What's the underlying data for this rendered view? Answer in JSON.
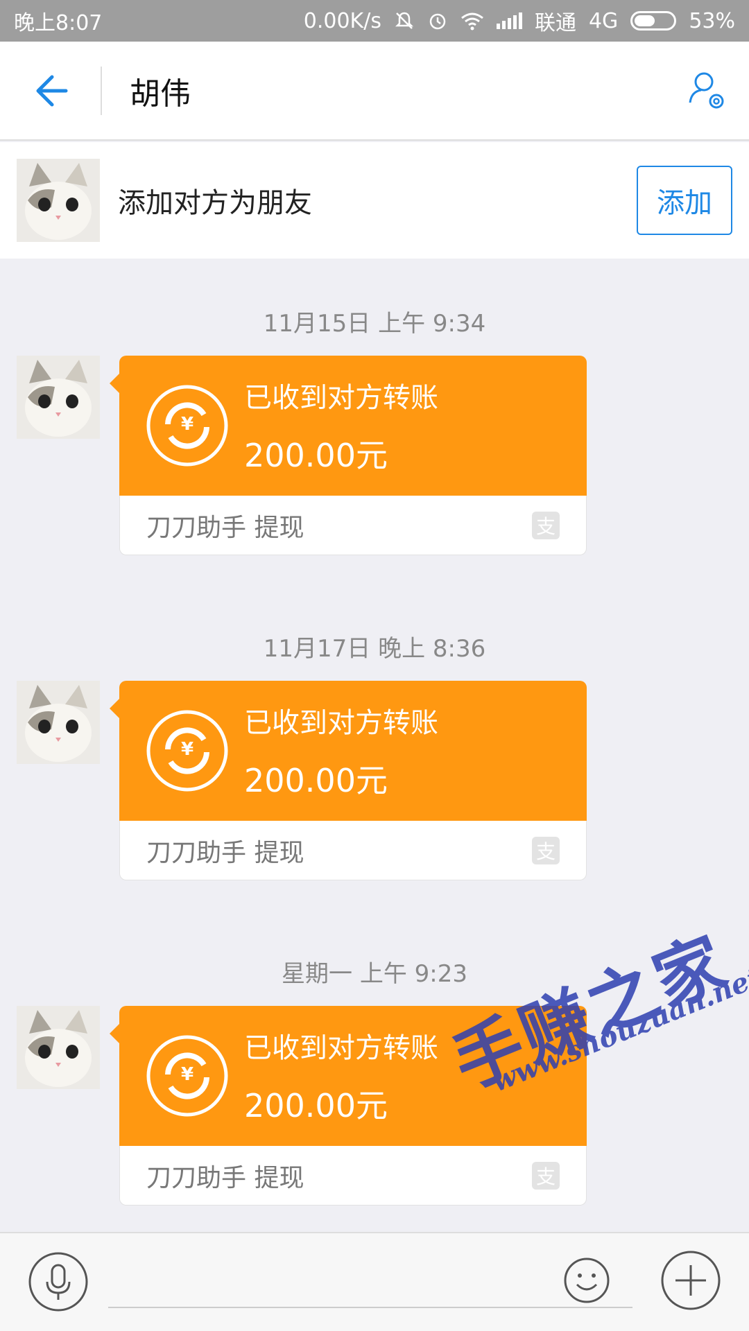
{
  "status_bar": {
    "time": "晚上8:07",
    "speed": "0.00K/s",
    "carrier": "联通",
    "network": "4G",
    "battery": "53%",
    "battery_level": 0.53
  },
  "header": {
    "title": "胡伟",
    "back_icon": "back-arrow-icon",
    "settings_icon": "user-settings-icon"
  },
  "add_friend": {
    "label": "添加对方为朋友",
    "button": "添加"
  },
  "messages": [
    {
      "timestamp": "11月15日 上午 9:34",
      "title": "已收到对方转账",
      "amount": "200.00元",
      "source": "刀刀助手 提现"
    },
    {
      "timestamp": "11月17日 晚上 8:36",
      "title": "已收到对方转账",
      "amount": "200.00元",
      "source": "刀刀助手 提现"
    },
    {
      "timestamp": "星期一 上午 9:23",
      "title": "已收到对方转账",
      "amount": "200.00元",
      "source": "刀刀助手 提现"
    }
  ],
  "input_bar": {
    "mic_icon": "microphone-icon",
    "emoji_icon": "smiley-icon",
    "plus_icon": "plus-icon",
    "placeholder": ""
  },
  "watermark": {
    "title": "手赚之家",
    "url": "www.shouzuan.net"
  },
  "colors": {
    "accent": "#1e88e5",
    "transfer_card": "#ff9811",
    "status_bar": "#9e9e9e"
  }
}
